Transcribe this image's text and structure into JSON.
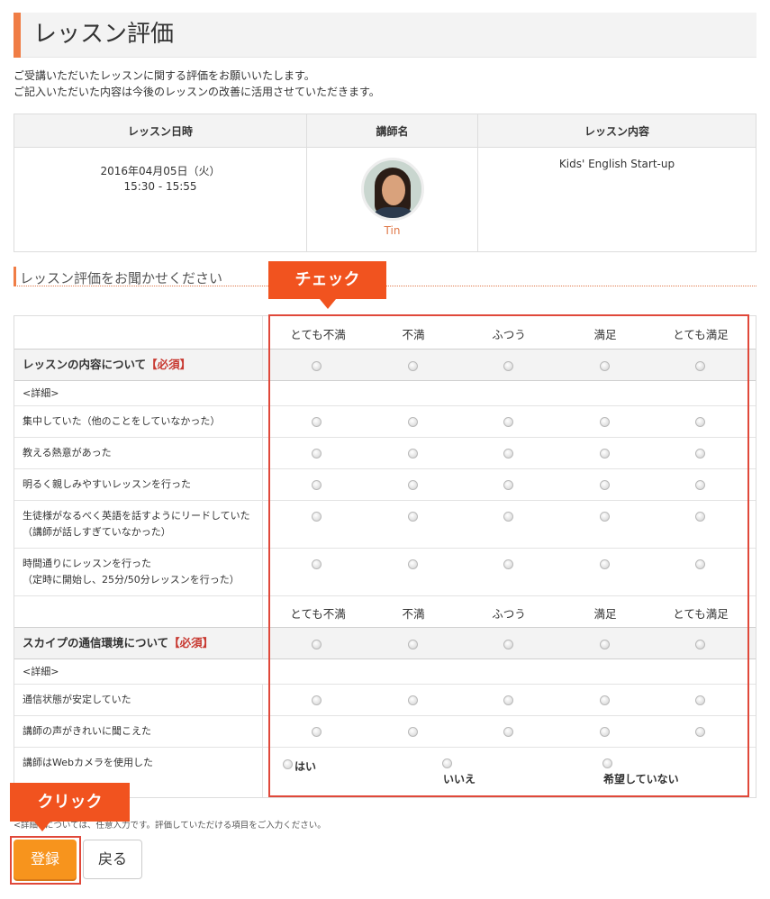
{
  "page": {
    "title": "レッスン評価",
    "intro_line1": "ご受講いただいたレッスンに関する評価をお願いいたします。",
    "intro_line2": "ご記入いただいた内容は今後のレッスンの改善に活用させていただきます。"
  },
  "info_table": {
    "headers": [
      "レッスン日時",
      "講師名",
      "レッスン内容"
    ],
    "date": "2016年04月05日（火）",
    "time": "15:30 - 15:55",
    "teacher": "Tin",
    "content": "Kids' English Start-up"
  },
  "section_title": "レッスン評価をお聞かせください",
  "rating_options": [
    "とても不満",
    "不満",
    "ふつう",
    "満足",
    "とても満足"
  ],
  "group1": {
    "title": "レッスンの内容について",
    "required": "【必須】",
    "detail_label": "<詳細>",
    "items": [
      {
        "line1": "集中していた（他のことをしていなかった）",
        "line2": ""
      },
      {
        "line1": "教える熱意があった",
        "line2": ""
      },
      {
        "line1": "明るく親しみやすいレッスンを行った",
        "line2": ""
      },
      {
        "line1": "生徒様がなるべく英語を話すようにリードしていた",
        "line2": "（講師が話しすぎていなかった）"
      },
      {
        "line1": "時間通りにレッスンを行った",
        "line2": "（定時に開始し、25分/50分レッスンを行った）"
      }
    ]
  },
  "group2": {
    "title": "スカイプの通信環境について",
    "required": "【必須】",
    "detail_label": "<詳細>",
    "items": [
      {
        "line1": "通信状態が安定していた"
      },
      {
        "line1": "講師の声がきれいに聞こえた"
      }
    ],
    "webcam": {
      "label": "講師はWebカメラを使用した",
      "options": [
        "はい",
        "いいえ",
        "希望していない"
      ]
    }
  },
  "note": "<詳細>については、任意入力です。評価していただける項目をご入力ください。",
  "buttons": {
    "submit": "登録",
    "back": "戻る"
  },
  "callouts": {
    "check": "チェック",
    "click": "クリック"
  },
  "colors": {
    "accent": "#f07d45",
    "callout": "#f1531f",
    "highlight": "#e0483a",
    "submit": "#f7941d",
    "required": "#c83a32"
  }
}
